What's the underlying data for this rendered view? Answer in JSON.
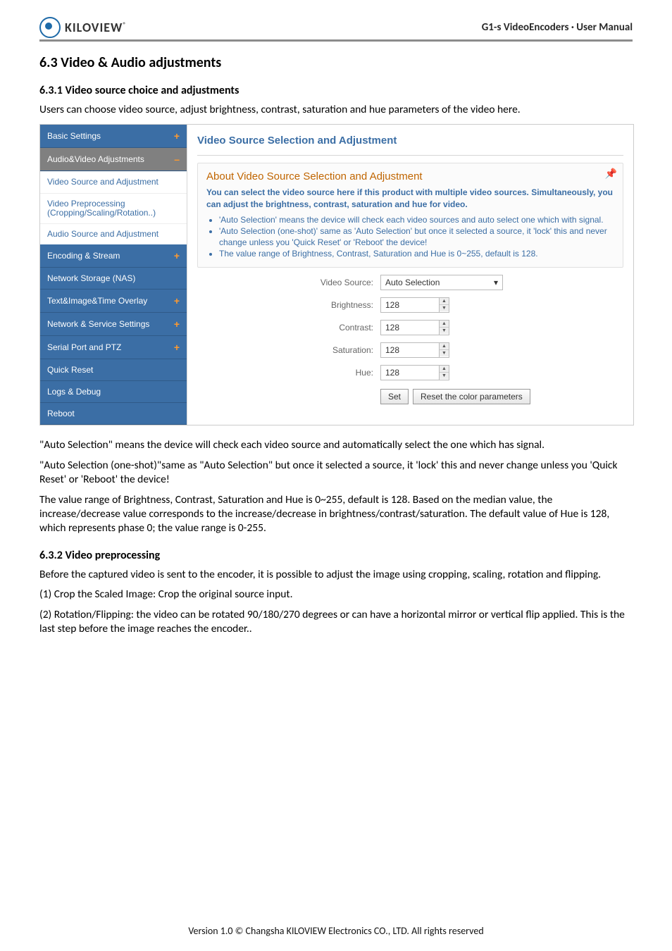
{
  "header": {
    "brand": "KILOVIEW",
    "trademark": "®",
    "doc_title": "G1-s VideoEncoders · User Manual"
  },
  "section": {
    "number_title": "6.3 Video & Audio adjustments",
    "sub1": {
      "number_title": "6.3.1   Video source choice and adjustments",
      "lead": "Users can choose video source, adjust brightness, contrast, saturation and hue parameters of the video here."
    },
    "sub2": {
      "number_title": "6.3.2   Video preprocessing",
      "lead": "Before the captured video is sent to the encoder, it is possible to adjust the image using cropping, scaling, rotation and flipping.",
      "p1": "(1) Crop the Scaled Image: Crop the original source input.",
      "p2": "(2) Rotation/Flipping: the video can be rotated 90/180/270 degrees or can have a horizontal mirror or vertical flip applied. This is the last step before the image reaches the encoder.."
    },
    "after_shot": {
      "p1": "\"Auto Selection\" means the device will check each video source and automatically select the one which has signal.",
      "p2": "\"Auto Selection (one-shot)\"same as \"Auto Selection\" but once it selected a source, it 'lock' this and never change unless you 'Quick Reset' or 'Reboot' the device!",
      "p3": "The value range of Brightness, Contrast, Saturation and Hue is 0~255, default is 128. Based on the median value, the increase/decrease value corresponds to the increase/decrease in brightness/contrast/saturation. The default value of Hue is 128, which represents phase 0; the value range is 0-255."
    }
  },
  "ui": {
    "side": {
      "basic": "Basic Settings",
      "av_adj": "Audio&Video Adjustments",
      "vs_adj": "Video Source and Adjustment",
      "vpre": "Video Preprocessing (Cropping/Scaling/Rotation..)",
      "as_adj": "Audio Source and Adjustment",
      "enc": "Encoding & Stream",
      "nas": "Network Storage (NAS)",
      "overlay": "Text&Image&Time Overlay",
      "netset": "Network & Service Settings",
      "ptz": "Serial Port and PTZ",
      "qreset": "Quick Reset",
      "logs": "Logs & Debug",
      "reboot": "Reboot",
      "plus": "+",
      "minus": "–"
    },
    "main": {
      "panel_title": "Video Source Selection and Adjustment",
      "about_title": "About Video Source Selection and Adjustment",
      "about_sub": "You can select the video source here if this product with multiple video sources. Simultaneously, you can adjust the brightness, contrast, saturation and hue for video.",
      "bullet1": "'Auto Selection' means the device will check each video sources and auto select one which with signal.",
      "bullet2": "'Auto Selection (one-shot)' same as 'Auto Selection' but once it selected a source, it 'lock' this and never change unless you 'Quick Reset' or 'Reboot' the device!",
      "bullet3": "The value range of Brightness, Contrast, Saturation and Hue is 0~255, default is 128.",
      "labels": {
        "video_source": "Video Source:",
        "brightness": "Brightness:",
        "contrast": "Contrast:",
        "saturation": "Saturation:",
        "hue": "Hue:"
      },
      "values": {
        "video_source": "Auto Selection",
        "brightness": "128",
        "contrast": "128",
        "saturation": "128",
        "hue": "128"
      },
      "buttons": {
        "set": "Set",
        "reset": "Reset the color parameters"
      }
    }
  },
  "footer": "Version 1.0 © Changsha KILOVIEW Electronics CO., LTD. All rights reserved"
}
